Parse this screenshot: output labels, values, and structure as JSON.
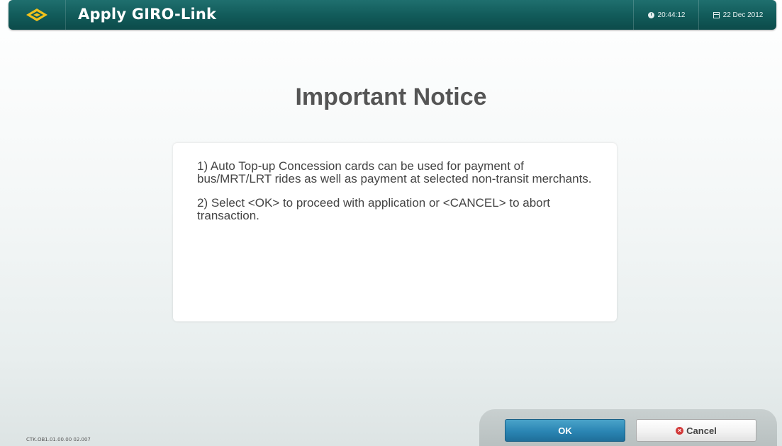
{
  "header": {
    "app_title": "Apply GIRO-Link",
    "logo_icon": "transit-logo-icon",
    "time": "20:44:12",
    "date": "22 Dec 2012",
    "colors": {
      "bar": "#115a59",
      "logo": "#f2c21b"
    }
  },
  "main": {
    "title": "Important Notice",
    "paragraphs": [
      "1) Auto Top-up Concession cards can be used for payment of bus/MRT/LRT rides as well as payment at selected non-transit merchants.",
      "2) Select <OK> to proceed with application or <CANCEL> to abort transaction."
    ]
  },
  "footer": {
    "ok_label": "OK",
    "cancel_label": "Cancel",
    "cancel_icon": "cancel-x-icon",
    "version": "CTK.OB1.01.00.00 02.007"
  }
}
